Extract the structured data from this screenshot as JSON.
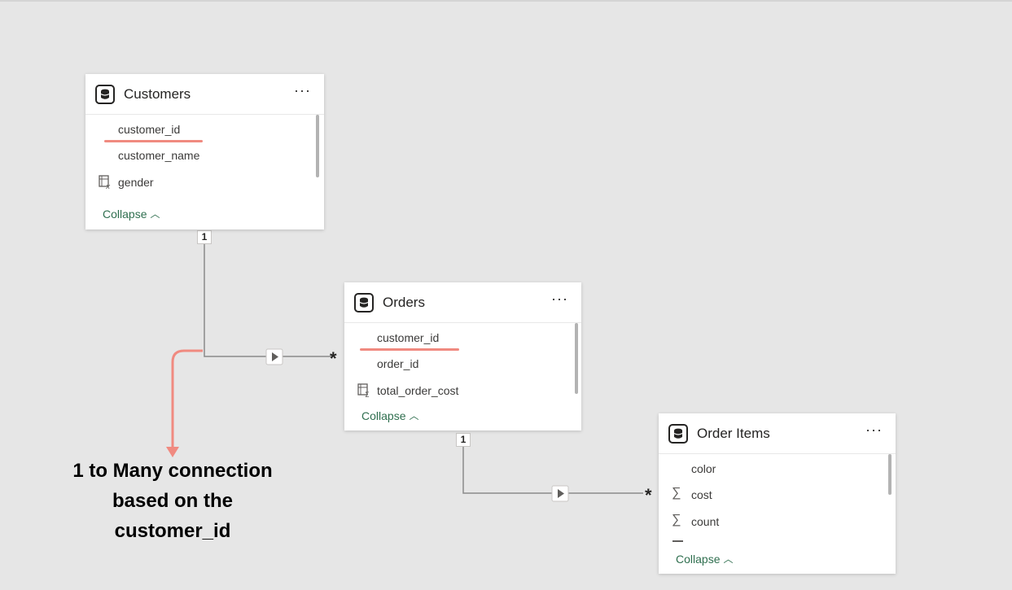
{
  "tables": {
    "customers": {
      "title": "Customers",
      "more": "···",
      "fields": [
        "customer_id",
        "customer_name",
        "gender"
      ],
      "collapse": "Collapse"
    },
    "orders": {
      "title": "Orders",
      "more": "···",
      "fields": [
        "customer_id",
        "order_id",
        "total_order_cost"
      ],
      "collapse": "Collapse"
    },
    "order_items": {
      "title": "Order Items",
      "more": "···",
      "fields": [
        "color",
        "cost",
        "count"
      ],
      "collapse": "Collapse"
    }
  },
  "relationships": {
    "customers_orders": {
      "one_label": "1",
      "many_label": "*"
    },
    "orders_order_items": {
      "one_label": "1",
      "many_label": "*"
    }
  },
  "annotation": {
    "line1": "1 to Many connection",
    "line2": "based on the",
    "line3": "customer_id"
  },
  "colors": {
    "background": "#e6e6e6",
    "highlight": "#f08a80",
    "collapse_link": "#2f6f4f",
    "connector": "#8a8a8a"
  },
  "icons": {
    "table": "table-database-icon",
    "measure": "sigma-icon",
    "calculated_column": "calculated-column-icon",
    "filter_direction": "triangle-arrow-icon"
  }
}
